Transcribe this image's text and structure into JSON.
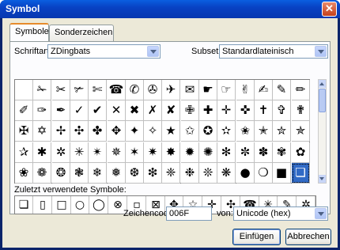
{
  "window": {
    "title": "Symbol"
  },
  "tabs": [
    {
      "label": "Symbole"
    },
    {
      "label": "Sonderzeichen"
    }
  ],
  "font": {
    "label": "Schriftart:",
    "value": "ZDingbats"
  },
  "subset": {
    "label": "Subset:",
    "value": "Standardlateinisch"
  },
  "grid": {
    "rows": [
      [
        "",
        "✁",
        "✂",
        "✃",
        "✄",
        "☎",
        "✆",
        "✇",
        "✈",
        "✉",
        "☛",
        "☞",
        "✌",
        "✍",
        "✎",
        "✏"
      ],
      [
        "✐",
        "✑",
        "✒",
        "✓",
        "✔",
        "✕",
        "✖",
        "✗",
        "✘",
        "✙",
        "✚",
        "✛",
        "✜",
        "✝",
        "✞",
        "✟"
      ],
      [
        "✠",
        "✡",
        "✢",
        "✣",
        "✤",
        "✥",
        "✦",
        "✧",
        "★",
        "✩",
        "✪",
        "✫",
        "✬",
        "✭",
        "✮",
        "✯"
      ],
      [
        "✰",
        "✱",
        "✲",
        "✳",
        "✴",
        "✵",
        "✶",
        "✷",
        "✸",
        "✹",
        "✺",
        "✻",
        "✼",
        "✽",
        "✾",
        "✿"
      ],
      [
        "❀",
        "❁",
        "❂",
        "❃",
        "❄",
        "❅",
        "❆",
        "❇",
        "❈",
        "❉",
        "❊",
        "❋",
        "●",
        "❍",
        "■",
        "❏"
      ]
    ]
  },
  "recent": {
    "label": "Zuletzt verwendete Symbole:",
    "symbols": [
      "❏",
      "▯",
      "□",
      "○",
      "◯",
      "⊗",
      "▫",
      "⊠",
      "✥",
      "☆",
      "✛",
      "✣",
      "☎",
      "✳",
      "✎",
      "✲"
    ]
  },
  "charcode": {
    "label": "Zeichencode:",
    "value": "006F"
  },
  "from": {
    "label": "von:",
    "value": "Unicode (hex)"
  },
  "buttons": {
    "insert": "Einfügen",
    "cancel": "Abbrechen"
  }
}
